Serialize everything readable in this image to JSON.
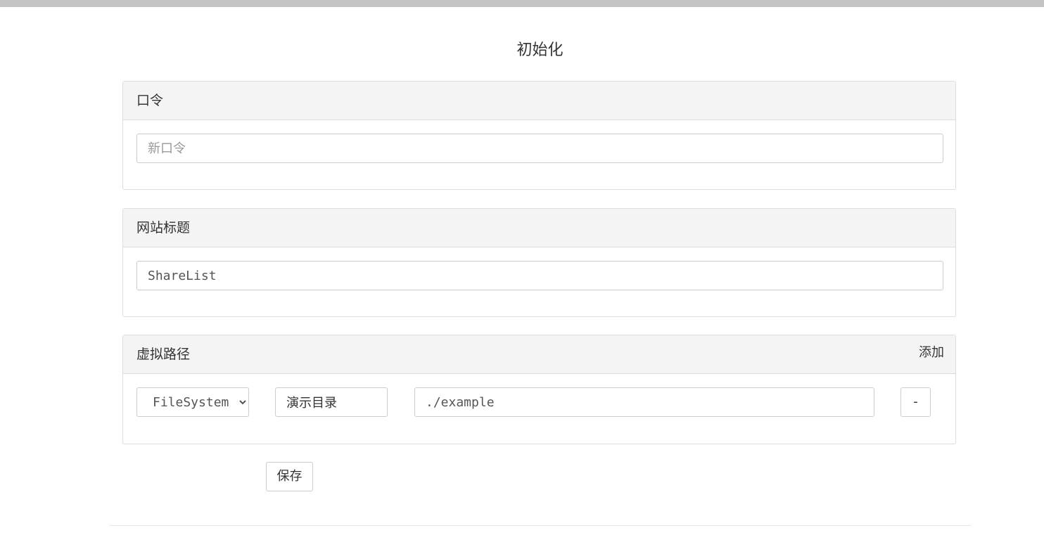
{
  "page": {
    "title": "初始化"
  },
  "password_panel": {
    "heading": "口令",
    "input_placeholder": "新口令",
    "input_value": ""
  },
  "site_title_panel": {
    "heading": "网站标题",
    "input_value": "ShareList"
  },
  "virtual_path_panel": {
    "heading": "虚拟路径",
    "add_label": "添加",
    "rows": [
      {
        "type_selected": "FileSystem",
        "type_options": [
          "FileSystem"
        ],
        "name": "演示目录",
        "path": "./example",
        "remove_label": "-"
      }
    ]
  },
  "save_label": "保存",
  "colors": {
    "top_bar": "#c3c3c3",
    "panel_heading_bg": "#f4f4f4",
    "border": "#dddddd"
  }
}
